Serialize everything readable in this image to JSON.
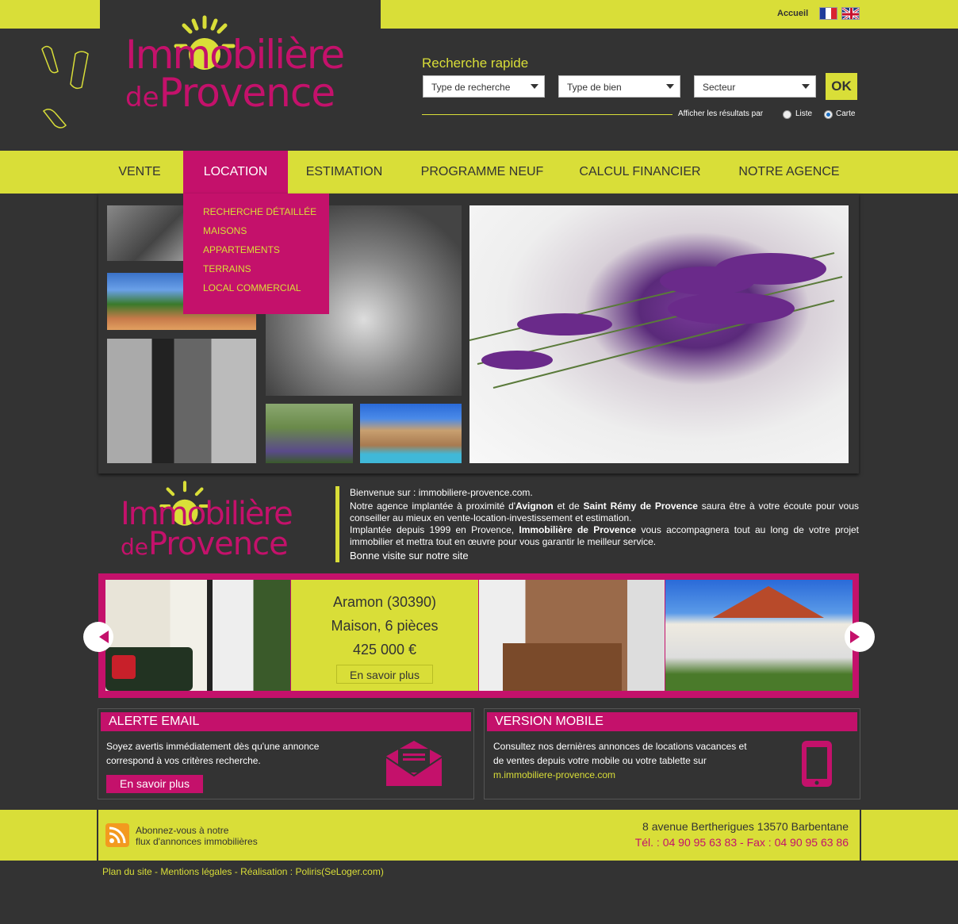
{
  "header": {
    "home_link": "Accueil",
    "flags": [
      "fr-flag-icon",
      "uk-flag-icon"
    ],
    "logo": {
      "line1": "Immobilière",
      "line2_small": "de",
      "line2_big": "Provence"
    }
  },
  "quick_search": {
    "title": "Recherche rapide",
    "select_type_recherche": "Type de recherche",
    "select_type_bien": "Type de bien",
    "select_secteur": "Secteur",
    "ok_label": "OK",
    "display_label": "Afficher les résultats par",
    "radio_liste": "Liste",
    "radio_carte": "Carte",
    "selected_display": "Carte"
  },
  "nav": {
    "items": [
      "VENTE",
      "LOCATION",
      "ESTIMATION",
      "PROGRAMME NEUF",
      "CALCUL FINANCIER",
      "NOTRE AGENCE"
    ],
    "active": "LOCATION",
    "dropdown": [
      "RECHERCHE DÉTAILLÉE",
      "MAISONS",
      "APPARTEMENTS",
      "TERRAINS",
      "LOCAL COMMERCIAL"
    ]
  },
  "intro": {
    "line1": "Bienvenue sur : immobiliere-provence.com.",
    "p2_a": "Notre agence implantée à proximité d'",
    "p2_b": "Avignon",
    "p2_c": " et de ",
    "p2_d": "Saint Rémy de Provence",
    "p2_e": " saura être à votre écoute pour vous conseiller au mieux en vente-location-investissement et estimation.",
    "p3_a": "Implantée depuis 1999 en Provence, ",
    "p3_b": "Immobilière de Provence",
    "p3_c": " vous accompagnera tout au long de votre projet immobilier et mettra tout en œuvre pour vous garantir le meilleur service.",
    "closing": "Bonne visite sur notre site"
  },
  "slider": {
    "location": "Aramon (30390)",
    "type": "Maison, 6 pièces",
    "price": "425 000 €",
    "button": "En savoir plus"
  },
  "alert_box": {
    "title": "ALERTE EMAIL",
    "text": "Soyez avertis immédiatement dès qu'une annonce correspond à vos critères recherche.",
    "button": "En savoir plus",
    "icon": "envelope-icon"
  },
  "mobile_box": {
    "title": "VERSION MOBILE",
    "text": "Consultez nos dernières annonces de locations vacances et de ventes depuis votre mobile ou votre tablette sur",
    "link": "m.immobiliere-provence.com",
    "icon": "mobile-phone-icon"
  },
  "footer": {
    "rss_line1": "Abonnez-vous à notre",
    "rss_line2": "flux d'annonces immobilières",
    "address": "8 avenue Bertherigues 13570 Barbentane",
    "phone": "Tél. : 04 90 95 63 83 - Fax : 04 90 95 63 86",
    "links": "Plan du site - Mentions légales - Réalisation : Poliris(SeLoger.com)"
  },
  "colors": {
    "accent_yellow": "#d9de38",
    "accent_pink": "#c4116b",
    "background": "#333333"
  }
}
